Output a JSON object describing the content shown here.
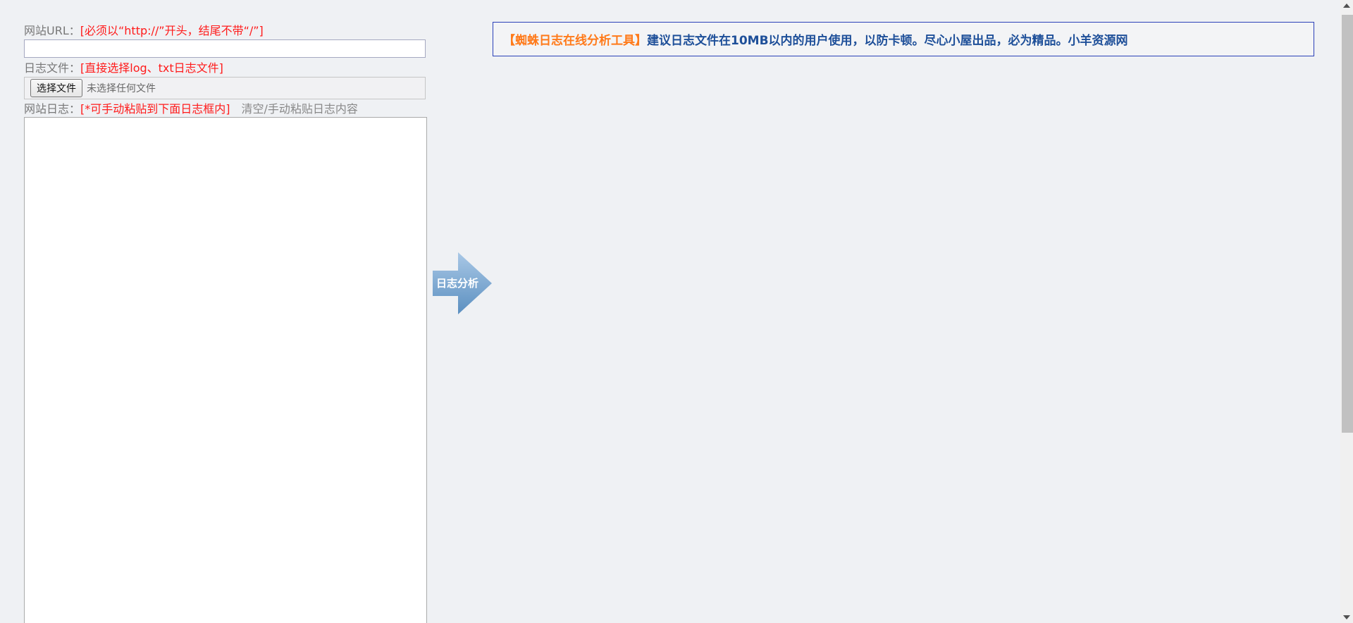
{
  "url_field": {
    "label": "网站URL：",
    "hint": "[必须以“http://”开头，结尾不带“/”]",
    "value": ""
  },
  "file_field": {
    "label": "日志文件：",
    "hint": "[直接选择log、txt日志文件]",
    "button_label": "选择文件",
    "status": "未选择任何文件"
  },
  "log_field": {
    "label": "网站日志：",
    "hint": "[*可手动粘贴到下面日志框内]",
    "clear_link": "清空/手动粘贴日志内容",
    "value": ""
  },
  "analyze_button": {
    "label": "日志分析",
    "color_top": "#a9c8e6",
    "color_bottom": "#5b8fc0"
  },
  "banner": {
    "title": "【蜘蛛日志在线分析工具】",
    "message": "建议日志文件在10MB以内的用户使用，以防卡顿。尽心小屋出品，必为精品。小羊资源网",
    "title_color": "#ff7a1a",
    "message_color": "#1e4f99"
  },
  "scrollbar": {
    "up_icon": "scroll-up-arrow",
    "down_icon": "scroll-down-arrow"
  }
}
